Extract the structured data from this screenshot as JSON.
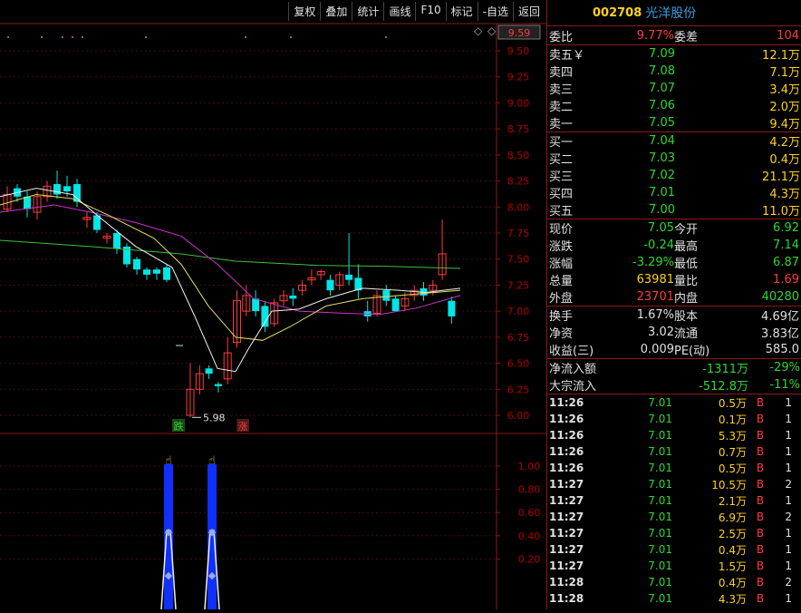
{
  "toolbar": [
    "复权",
    "叠加",
    "统计",
    "画线",
    "F10",
    "标记",
    "-自选",
    "返回"
  ],
  "stock": {
    "code": "002708",
    "name": "光洋股份"
  },
  "price_axis": [
    "9.50",
    "9.25",
    "9.00",
    "8.75",
    "8.50",
    "8.25",
    "8.00",
    "7.75",
    "7.50",
    "7.25",
    "7.00",
    "6.75",
    "6.50",
    "6.25",
    "6.00"
  ],
  "price_tag": "9.59",
  "low_label": "5.98",
  "marker_down": "跌",
  "marker_up": "涨",
  "indicator_axis": [
    "1.00",
    "0.80",
    "0.60",
    "0.40",
    "0.20"
  ],
  "weibi": {
    "label": "委比",
    "value": "9.77%",
    "label2": "委差",
    "value2": "104"
  },
  "asks": [
    {
      "label": "卖五￥",
      "price": "7.09",
      "vol": "12.1万"
    },
    {
      "label": "卖四",
      "price": "7.08",
      "vol": "7.1万"
    },
    {
      "label": "卖三",
      "price": "7.07",
      "vol": "3.4万"
    },
    {
      "label": "卖二",
      "price": "7.06",
      "vol": "2.0万"
    },
    {
      "label": "卖一",
      "price": "7.05",
      "vol": "9.4万"
    }
  ],
  "bids": [
    {
      "label": "买一",
      "price": "7.04",
      "vol": "4.2万"
    },
    {
      "label": "买二",
      "price": "7.03",
      "vol": "0.4万"
    },
    {
      "label": "买三",
      "price": "7.02",
      "vol": "21.1万"
    },
    {
      "label": "买四",
      "price": "7.01",
      "vol": "4.3万"
    },
    {
      "label": "买五",
      "price": "7.00",
      "vol": "11.0万"
    }
  ],
  "quote": [
    {
      "l1": "现价",
      "v1": "7.05",
      "c1": "g",
      "l2": "今开",
      "v2": "6.92",
      "c2": "g"
    },
    {
      "l1": "涨跌",
      "v1": "-0.24",
      "c1": "g",
      "l2": "最高",
      "v2": "7.14",
      "c2": "g"
    },
    {
      "l1": "涨幅",
      "v1": "-3.29%",
      "c1": "g",
      "l2": "最低",
      "v2": "6.87",
      "c2": "g"
    },
    {
      "l1": "总量",
      "v1": "63981",
      "c1": "y",
      "l2": "量比",
      "v2": "1.69",
      "c2": "r"
    },
    {
      "l1": "外盘",
      "v1": "23701",
      "c1": "r",
      "l2": "内盘",
      "v2": "40280",
      "c2": "g"
    }
  ],
  "fund": [
    {
      "l1": "换手",
      "v1": "1.67%",
      "l2": "股本",
      "v2": "4.69亿"
    },
    {
      "l1": "净资",
      "v1": "3.02",
      "l2": "流通",
      "v2": "3.83亿"
    },
    {
      "l1": "收益(三)",
      "v1": "0.009",
      "l2": "PE(动)",
      "v2": "585.0"
    }
  ],
  "flow": [
    {
      "label": "净流入额",
      "amount": "-1311万",
      "pct": "-29%"
    },
    {
      "label": "大宗流入",
      "amount": "-512.8万",
      "pct": "-11%"
    }
  ],
  "ticks": [
    {
      "time": "11:26",
      "price": "7.01",
      "vol": "0.5万",
      "side": "B",
      "n": "1"
    },
    {
      "time": "11:26",
      "price": "7.01",
      "vol": "0.1万",
      "side": "B",
      "n": "1"
    },
    {
      "time": "11:26",
      "price": "7.01",
      "vol": "5.3万",
      "side": "B",
      "n": "1"
    },
    {
      "time": "11:26",
      "price": "7.01",
      "vol": "0.7万",
      "side": "B",
      "n": "1"
    },
    {
      "time": "11:26",
      "price": "7.01",
      "vol": "0.5万",
      "side": "B",
      "n": "1"
    },
    {
      "time": "11:27",
      "price": "7.01",
      "vol": "10.5万",
      "side": "B",
      "n": "2"
    },
    {
      "time": "11:27",
      "price": "7.01",
      "vol": "2.1万",
      "side": "B",
      "n": "1"
    },
    {
      "time": "11:27",
      "price": "7.01",
      "vol": "6.9万",
      "side": "B",
      "n": "2"
    },
    {
      "time": "11:27",
      "price": "7.01",
      "vol": "2.5万",
      "side": "B",
      "n": "1"
    },
    {
      "time": "11:27",
      "price": "7.01",
      "vol": "0.4万",
      "side": "B",
      "n": "1"
    },
    {
      "time": "11:27",
      "price": "7.01",
      "vol": "1.5万",
      "side": "B",
      "n": "1"
    },
    {
      "time": "11:28",
      "price": "7.01",
      "vol": "0.4万",
      "side": "B",
      "n": "2"
    },
    {
      "time": "11:28",
      "price": "7.01",
      "vol": "4.3万",
      "side": "B",
      "n": "1"
    }
  ],
  "chart_data": {
    "type": "candlestick",
    "ylim": [
      5.9,
      9.6
    ],
    "candles": [
      [
        7.98,
        8.12,
        7.95,
        8.2
      ],
      [
        8.18,
        8.1,
        8.05,
        8.22
      ],
      [
        8.1,
        7.98,
        7.9,
        8.15
      ],
      [
        7.95,
        8.1,
        7.88,
        8.15
      ],
      [
        8.1,
        8.2,
        8.05,
        8.25
      ],
      [
        8.22,
        8.12,
        8.08,
        8.35
      ],
      [
        8.2,
        8.15,
        8.1,
        8.3
      ],
      [
        8.22,
        8.05,
        8.0,
        8.27
      ],
      [
        7.88,
        7.9,
        7.8,
        7.95
      ],
      [
        7.92,
        7.78,
        7.75,
        7.95
      ],
      [
        7.7,
        7.72,
        7.65,
        7.75
      ],
      [
        7.75,
        7.6,
        7.55,
        7.78
      ],
      [
        7.62,
        7.45,
        7.42,
        7.65
      ],
      [
        7.5,
        7.4,
        7.35,
        7.52
      ],
      [
        7.4,
        7.35,
        7.3,
        7.42
      ],
      [
        7.4,
        7.36,
        7.3,
        7.42
      ],
      [
        7.42,
        7.3,
        7.28,
        7.45
      ]
    ],
    "candles2": [
      [
        6.0,
        6.25,
        5.98,
        6.5
      ],
      [
        6.25,
        6.4,
        6.2,
        6.48
      ],
      [
        6.45,
        6.4,
        6.35,
        6.48
      ],
      [
        6.3,
        6.28,
        6.22,
        6.32
      ],
      [
        6.35,
        6.6,
        6.3,
        6.75
      ],
      [
        6.7,
        7.1,
        6.65,
        7.2
      ],
      [
        7.0,
        7.15,
        6.95,
        7.25
      ],
      [
        7.12,
        7.0,
        6.95,
        7.2
      ],
      [
        7.05,
        6.85,
        6.8,
        7.1
      ],
      [
        6.88,
        7.08,
        6.85,
        7.12
      ],
      [
        7.1,
        7.15,
        7.05,
        7.2
      ],
      [
        7.15,
        7.12,
        7.05,
        7.22
      ],
      [
        7.2,
        7.25,
        7.15,
        7.3
      ],
      [
        7.3,
        7.32,
        7.25,
        7.4
      ],
      [
        7.35,
        7.38,
        7.3,
        7.4
      ],
      [
        7.3,
        7.2,
        7.15,
        7.35
      ],
      [
        7.25,
        7.35,
        7.2,
        7.38
      ],
      [
        7.35,
        7.3,
        7.25,
        7.75
      ],
      [
        7.32,
        7.2,
        7.12,
        7.45
      ],
      [
        7.0,
        6.95,
        6.9,
        7.1
      ],
      [
        6.98,
        7.15,
        6.95,
        7.2
      ],
      [
        7.2,
        7.1,
        7.05,
        7.25
      ],
      [
        7.12,
        7.0,
        7.0,
        7.15
      ],
      [
        7.05,
        7.12,
        7.0,
        7.18
      ],
      [
        7.15,
        7.2,
        7.1,
        7.25
      ],
      [
        7.22,
        7.15,
        7.1,
        7.28
      ],
      [
        7.2,
        7.25,
        7.15,
        7.3
      ],
      [
        7.35,
        7.55,
        7.3,
        7.88
      ],
      [
        7.1,
        6.95,
        6.88,
        7.14
      ]
    ]
  }
}
